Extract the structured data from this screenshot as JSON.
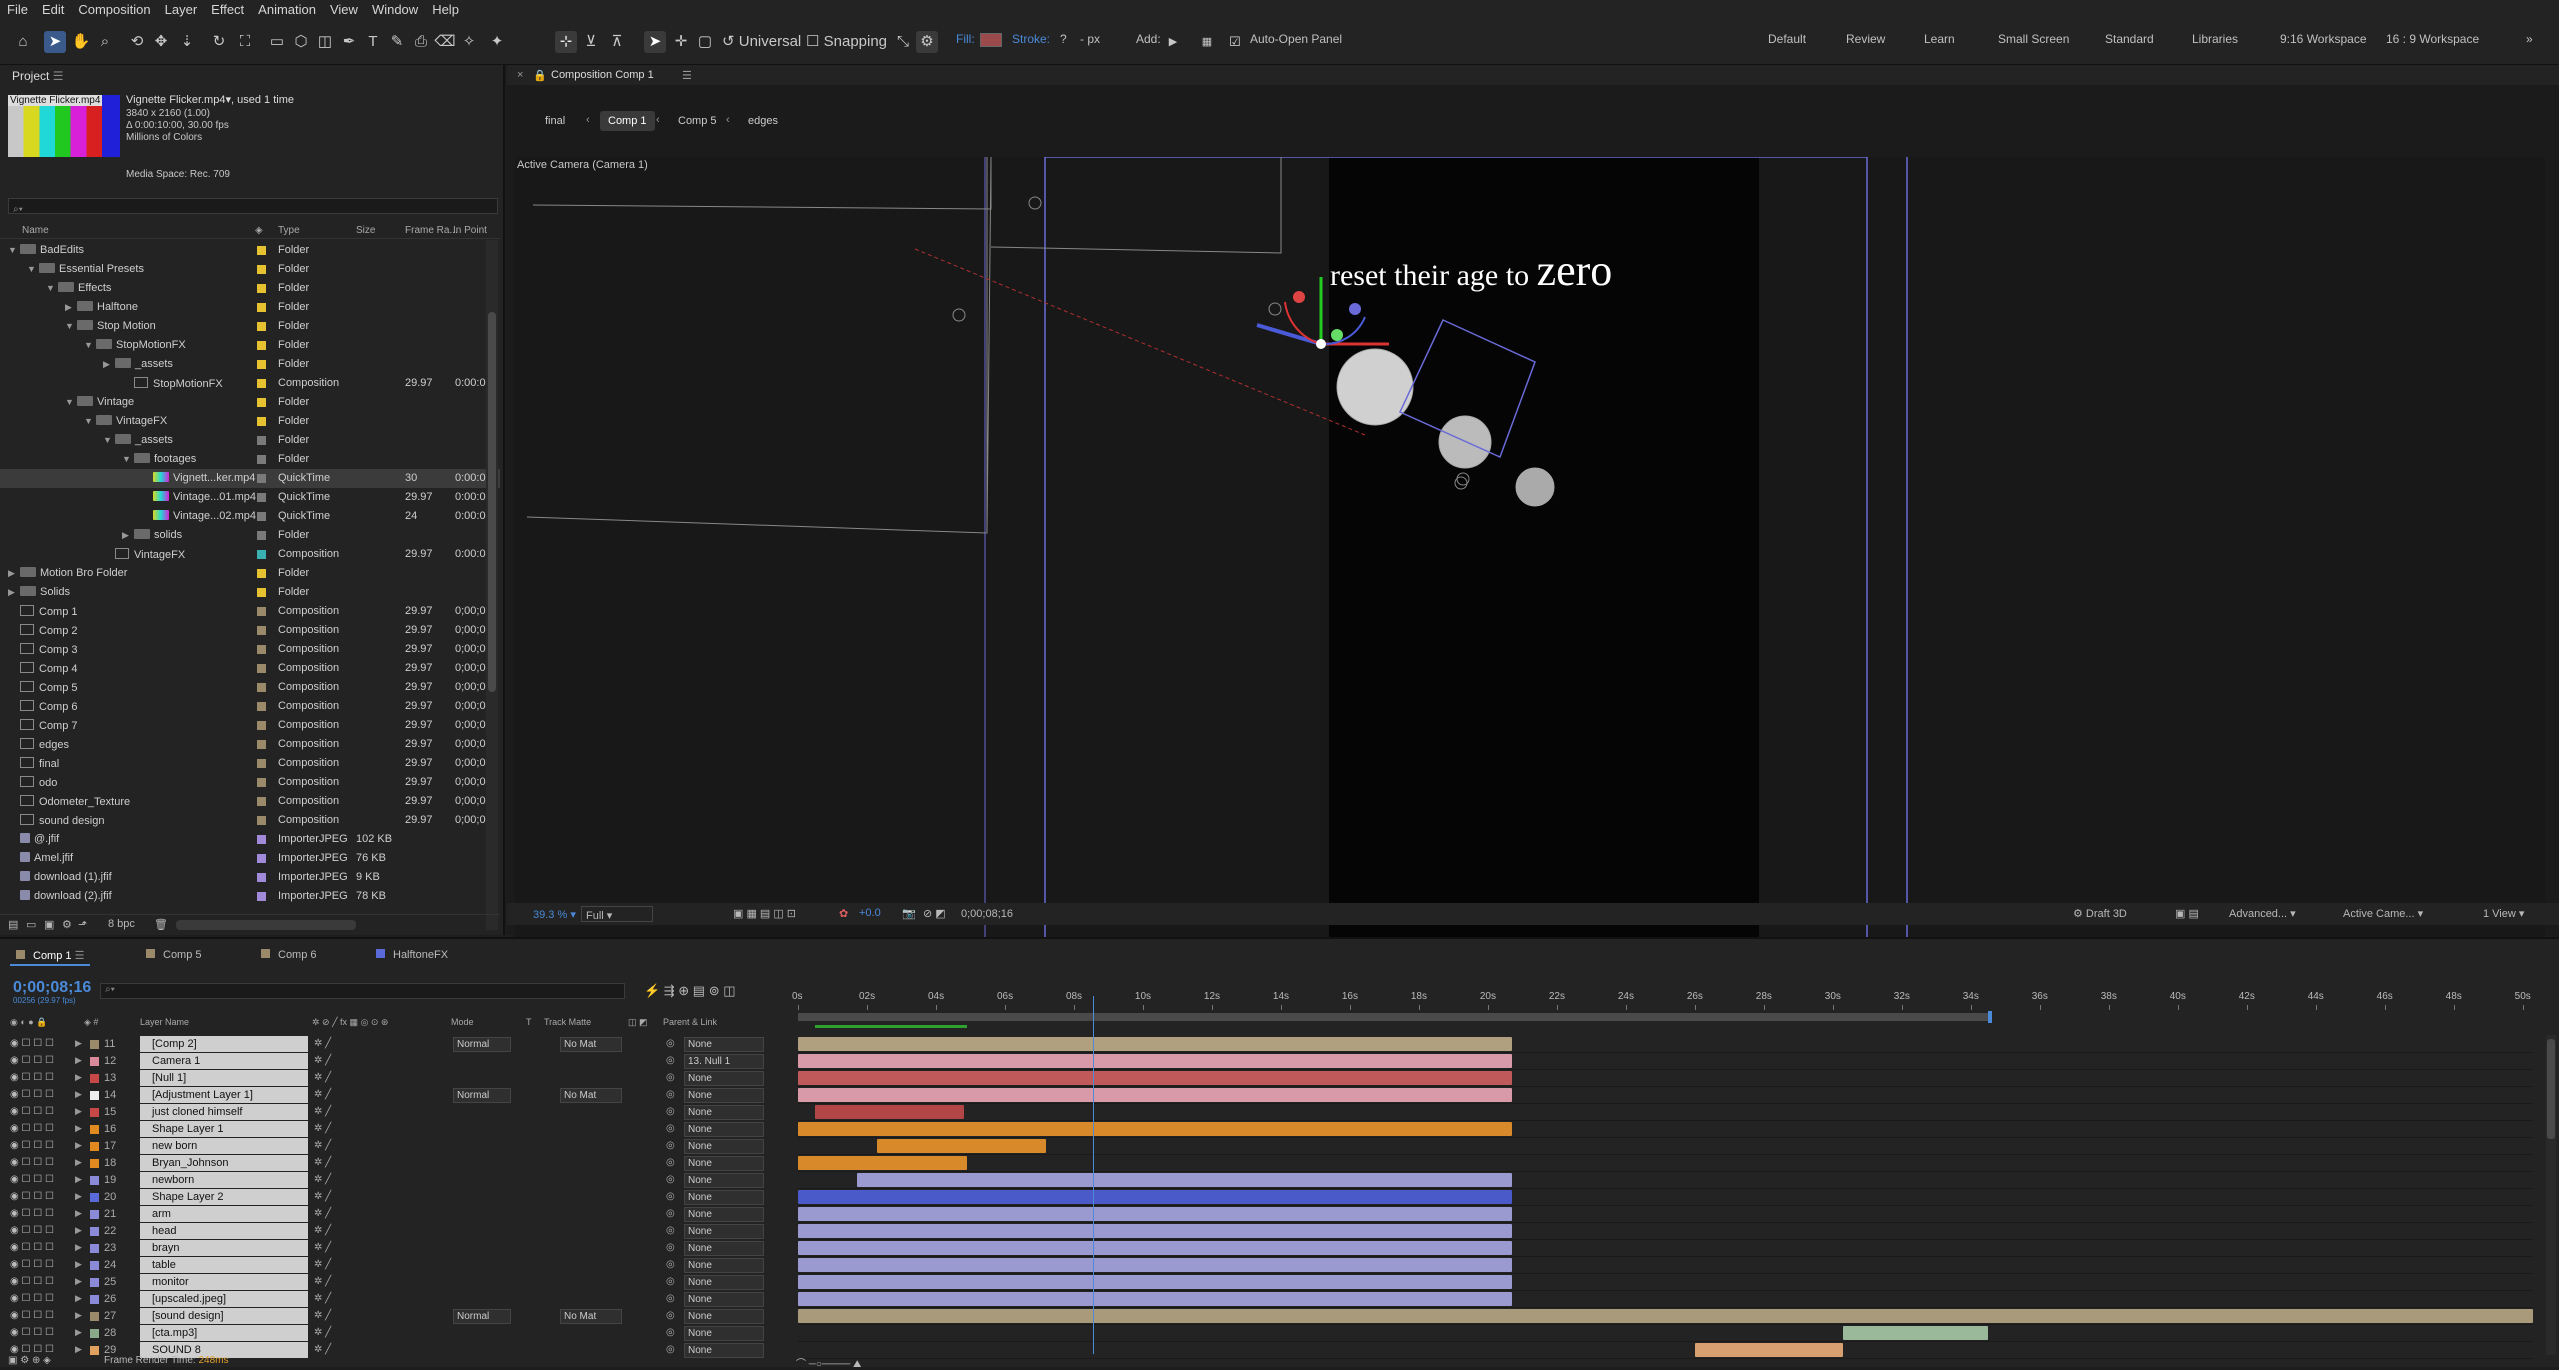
{
  "menu": [
    "File",
    "Edit",
    "Composition",
    "Layer",
    "Effect",
    "Animation",
    "View",
    "Window",
    "Help"
  ],
  "toolbar": {
    "universal": "Universal",
    "snapping": "Snapping",
    "fill": "Fill:",
    "stroke": "Stroke:",
    "stroke_val": "?",
    "px": "- px",
    "add": "Add:",
    "auto_open": "Auto-Open Panel"
  },
  "workspaces": [
    "Default",
    "Review",
    "Learn",
    "Small Screen",
    "Standard",
    "Libraries",
    "9:16 Workspace",
    "16 : 9 Workspace"
  ],
  "project": {
    "title": "Project",
    "file_name": "Vignette Flicker.mp4",
    "used": ", used 1 time",
    "res": "3840 x 2160 (1.00)",
    "dur": "Δ 0:00:10:00, 30.00 fps",
    "colors": "Millions of Colors",
    "media_space": "Media Space: Rec. 709",
    "search_placeholder": "⌕▾",
    "cols": {
      "name": "Name",
      "type": "Type",
      "size": "Size",
      "frame_rate": "Frame Ra...",
      "in_point": "In Point"
    },
    "rows": [
      {
        "name": "BadEdits",
        "type": "Folder",
        "size": "",
        "fr": "",
        "ip": "",
        "indent": 0,
        "tri": "v",
        "color": "#e6c230",
        "icon": "folder"
      },
      {
        "name": "Essential Presets",
        "type": "Folder",
        "size": "",
        "fr": "",
        "ip": "",
        "indent": 1,
        "tri": "v",
        "color": "#e6c230",
        "icon": "folder"
      },
      {
        "name": "Effects",
        "type": "Folder",
        "size": "",
        "fr": "",
        "ip": "",
        "indent": 2,
        "tri": "v",
        "color": "#e6c230",
        "icon": "folder"
      },
      {
        "name": "Halftone",
        "type": "Folder",
        "size": "",
        "fr": "",
        "ip": "",
        "indent": 3,
        "tri": ">",
        "color": "#e6c230",
        "icon": "folder"
      },
      {
        "name": "Stop Motion",
        "type": "Folder",
        "size": "",
        "fr": "",
        "ip": "",
        "indent": 3,
        "tri": "v",
        "color": "#e6c230",
        "icon": "folder"
      },
      {
        "name": "StopMotionFX",
        "type": "Folder",
        "size": "",
        "fr": "",
        "ip": "",
        "indent": 4,
        "tri": "v",
        "color": "#e6c230",
        "icon": "folder"
      },
      {
        "name": "_assets",
        "type": "Folder",
        "size": "",
        "fr": "",
        "ip": "",
        "indent": 5,
        "tri": ">",
        "color": "#e6c230",
        "icon": "folder"
      },
      {
        "name": "StopMotionFX",
        "type": "Composition",
        "size": "",
        "fr": "29.97",
        "ip": "0:00:0",
        "indent": 6,
        "tri": "",
        "color": "#e6c230",
        "icon": "comp"
      },
      {
        "name": "Vintage",
        "type": "Folder",
        "size": "",
        "fr": "",
        "ip": "",
        "indent": 3,
        "tri": "v",
        "color": "#e6c230",
        "icon": "folder"
      },
      {
        "name": "VintageFX",
        "type": "Folder",
        "size": "",
        "fr": "",
        "ip": "",
        "indent": 4,
        "tri": "v",
        "color": "#e6c230",
        "icon": "folder"
      },
      {
        "name": "_assets",
        "type": "Folder",
        "size": "",
        "fr": "",
        "ip": "",
        "indent": 5,
        "tri": "v",
        "color": "#7a7a7a",
        "icon": "folder"
      },
      {
        "name": "footages",
        "type": "Folder",
        "size": "",
        "fr": "",
        "ip": "",
        "indent": 6,
        "tri": "v",
        "color": "#7a7a7a",
        "icon": "folder"
      },
      {
        "name": "Vignett...ker.mp4",
        "type": "QuickTime",
        "size": "",
        "fr": "30",
        "ip": "0:00:0",
        "indent": 7,
        "tri": "",
        "color": "#7a7a7a",
        "icon": "media",
        "sel": true
      },
      {
        "name": "Vintage...01.mp4",
        "type": "QuickTime",
        "size": "",
        "fr": "29.97",
        "ip": "0:00:0",
        "indent": 7,
        "tri": "",
        "color": "#7a7a7a",
        "icon": "media"
      },
      {
        "name": "Vintage...02.mp4",
        "type": "QuickTime",
        "size": "",
        "fr": "24",
        "ip": "0:00:0",
        "indent": 7,
        "tri": "",
        "color": "#7a7a7a",
        "icon": "media"
      },
      {
        "name": "solids",
        "type": "Folder",
        "size": "",
        "fr": "",
        "ip": "",
        "indent": 6,
        "tri": ">",
        "color": "#7a7a7a",
        "icon": "folder"
      },
      {
        "name": "VintageFX",
        "type": "Composition",
        "size": "",
        "fr": "29.97",
        "ip": "0:00:0",
        "indent": 5,
        "tri": "",
        "color": "#3ab0b0",
        "icon": "comp"
      },
      {
        "name": "Motion Bro Folder",
        "type": "Folder",
        "size": "",
        "fr": "",
        "ip": "",
        "indent": 0,
        "tri": ">",
        "color": "#e6c230",
        "icon": "folder"
      },
      {
        "name": "Solids",
        "type": "Folder",
        "size": "",
        "fr": "",
        "ip": "",
        "indent": 0,
        "tri": ">",
        "color": "#e6c230",
        "icon": "folder"
      },
      {
        "name": "Comp 1",
        "type": "Composition",
        "size": "",
        "fr": "29.97",
        "ip": "0;00;0",
        "indent": 0,
        "tri": "",
        "color": "#9a8a6a",
        "icon": "comp"
      },
      {
        "name": "Comp 2",
        "type": "Composition",
        "size": "",
        "fr": "29.97",
        "ip": "0;00;0",
        "indent": 0,
        "tri": "",
        "color": "#9a8a6a",
        "icon": "comp"
      },
      {
        "name": "Comp 3",
        "type": "Composition",
        "size": "",
        "fr": "29.97",
        "ip": "0;00;0",
        "indent": 0,
        "tri": "",
        "color": "#9a8a6a",
        "icon": "comp"
      },
      {
        "name": "Comp 4",
        "type": "Composition",
        "size": "",
        "fr": "29.97",
        "ip": "0;00;0",
        "indent": 0,
        "tri": "",
        "color": "#9a8a6a",
        "icon": "comp"
      },
      {
        "name": "Comp 5",
        "type": "Composition",
        "size": "",
        "fr": "29.97",
        "ip": "0;00;0",
        "indent": 0,
        "tri": "",
        "color": "#9a8a6a",
        "icon": "comp"
      },
      {
        "name": "Comp 6",
        "type": "Composition",
        "size": "",
        "fr": "29.97",
        "ip": "0;00;0",
        "indent": 0,
        "tri": "",
        "color": "#9a8a6a",
        "icon": "comp"
      },
      {
        "name": "Comp 7",
        "type": "Composition",
        "size": "",
        "fr": "29.97",
        "ip": "0;00;0",
        "indent": 0,
        "tri": "",
        "color": "#9a8a6a",
        "icon": "comp"
      },
      {
        "name": "edges",
        "type": "Composition",
        "size": "",
        "fr": "29.97",
        "ip": "0;00;0",
        "indent": 0,
        "tri": "",
        "color": "#9a8a6a",
        "icon": "comp"
      },
      {
        "name": "final",
        "type": "Composition",
        "size": "",
        "fr": "29.97",
        "ip": "0;00;0",
        "indent": 0,
        "tri": "",
        "color": "#9a8a6a",
        "icon": "comp"
      },
      {
        "name": "odo",
        "type": "Composition",
        "size": "",
        "fr": "29.97",
        "ip": "0;00;0",
        "indent": 0,
        "tri": "",
        "color": "#9a8a6a",
        "icon": "comp"
      },
      {
        "name": "Odometer_Texture",
        "type": "Composition",
        "size": "",
        "fr": "29.97",
        "ip": "0;00;0",
        "indent": 0,
        "tri": "",
        "color": "#9a8a6a",
        "icon": "comp"
      },
      {
        "name": "sound design",
        "type": "Composition",
        "size": "",
        "fr": "29.97",
        "ip": "0;00;0",
        "indent": 0,
        "tri": "",
        "color": "#9a8a6a",
        "icon": "comp"
      },
      {
        "name": "@.jfif",
        "type": "ImporterJPEG",
        "size": "102 KB",
        "fr": "",
        "ip": "",
        "indent": 0,
        "tri": "",
        "color": "#a18ad8",
        "icon": "file"
      },
      {
        "name": "Amel.jfif",
        "type": "ImporterJPEG",
        "size": "76 KB",
        "fr": "",
        "ip": "",
        "indent": 0,
        "tri": "",
        "color": "#a18ad8",
        "icon": "file"
      },
      {
        "name": "download (1).jfif",
        "type": "ImporterJPEG",
        "size": "9 KB",
        "fr": "",
        "ip": "",
        "indent": 0,
        "tri": "",
        "color": "#a18ad8",
        "icon": "file"
      },
      {
        "name": "download (2).jfif",
        "type": "ImporterJPEG",
        "size": "78 KB",
        "fr": "",
        "ip": "",
        "indent": 0,
        "tri": "",
        "color": "#a18ad8",
        "icon": "file"
      }
    ],
    "bpc": "8 bpc"
  },
  "comp": {
    "panel_title": "Composition Comp 1",
    "breadcrumbs": [
      "final",
      "Comp 1",
      "Comp 5",
      "edges"
    ],
    "camera_label": "Active Camera (Camera 1)",
    "headline": "reset their age to ",
    "headline_big": "zero",
    "zoom": "39.3",
    "zoom_unit": "%",
    "resolution": "Full",
    "exposure": "+0.0",
    "timecode": "0;00;08;16",
    "renderer": "Draft 3D",
    "advanced": "Advanced...",
    "camera_select": "Active Came...",
    "views": "1 View"
  },
  "timeline": {
    "tabs": [
      {
        "name": "Comp 1",
        "color": "#9a8a6a"
      },
      {
        "name": "Comp 5",
        "color": "#9a8a6a"
      },
      {
        "name": "Comp 6",
        "color": "#9a8a6a"
      },
      {
        "name": "HalftoneFX",
        "color": "#5a6ad8"
      }
    ],
    "timecode": "0;00;08;16",
    "frames": "00256 (29.97 fps)",
    "search_placeholder": "⌕▾",
    "col_layer": "Layer Name",
    "col_mode": "Mode",
    "col_t": "T",
    "col_matte": "Track Matte",
    "col_parent": "Parent & Link",
    "ticks": [
      "0s",
      "02s",
      "04s",
      "06s",
      "08s",
      "10s",
      "12s",
      "14s",
      "16s",
      "18s",
      "20s",
      "22s",
      "24s",
      "26s",
      "28s",
      "30s",
      "32s",
      "34s",
      "36s",
      "38s",
      "40s",
      "42s",
      "44s",
      "46s",
      "48s",
      "50s"
    ],
    "render_time_label": "Frame Render Time: ",
    "render_time": "248ms",
    "layers": [
      {
        "n": "11",
        "name": "[Comp 2]",
        "color": "#9a8a6a",
        "mode": "Normal",
        "matte": "No Mat",
        "parent": "None",
        "start": 0.0,
        "end": 20.7,
        "bar": "#b0a080"
      },
      {
        "n": "12",
        "name": "Camera 1",
        "color": "#d88a9a",
        "mode": "",
        "matte": "",
        "parent": "13. Null 1",
        "start": 0.0,
        "end": 20.7,
        "bar": "#d89aa8"
      },
      {
        "n": "13",
        "name": "[Null 1]",
        "color": "#c84848",
        "mode": "",
        "matte": "",
        "parent": "None",
        "start": 0.0,
        "end": 20.7,
        "bar": "#c05a5a"
      },
      {
        "n": "14",
        "name": "[Adjustment Layer 1]",
        "color": "#eeeeee",
        "mode": "Normal",
        "matte": "No Mat",
        "parent": "None",
        "start": 0.0,
        "end": 20.7,
        "bar": "#d89aa8"
      },
      {
        "n": "15",
        "name": "just cloned himself",
        "color": "#c84848",
        "mode": "",
        "matte": "",
        "parent": "None",
        "start": 0.5,
        "end": 4.8,
        "bar": "#b24646"
      },
      {
        "n": "16",
        "name": "Shape Layer 1",
        "color": "#e08a20",
        "mode": "",
        "matte": "",
        "parent": "None",
        "start": 0.0,
        "end": 20.7,
        "bar": "#d88a2a"
      },
      {
        "n": "17",
        "name": "new born",
        "color": "#e08a20",
        "mode": "",
        "matte": "",
        "parent": "None",
        "start": 2.3,
        "end": 7.2,
        "bar": "#d88a2a"
      },
      {
        "n": "18",
        "name": "Bryan_Johnson",
        "color": "#e08a20",
        "mode": "",
        "matte": "",
        "parent": "None",
        "start": 0.0,
        "end": 4.9,
        "bar": "#d88a2a"
      },
      {
        "n": "19",
        "name": "newborn",
        "color": "#8a8ad8",
        "mode": "",
        "matte": "",
        "parent": "None",
        "start": 1.7,
        "end": 20.7,
        "bar": "#9a9ad0"
      },
      {
        "n": "20",
        "name": "Shape Layer 2",
        "color": "#5a6ad8",
        "mode": "",
        "matte": "",
        "parent": "None",
        "start": 0.0,
        "end": 20.7,
        "bar": "#4a5ac8"
      },
      {
        "n": "21",
        "name": "arm",
        "color": "#8a8ad8",
        "mode": "",
        "matte": "",
        "parent": "None",
        "start": 0.0,
        "end": 20.7,
        "bar": "#9a9ad0"
      },
      {
        "n": "22",
        "name": "head",
        "color": "#8a8ad8",
        "mode": "",
        "matte": "",
        "parent": "None",
        "start": 0.0,
        "end": 20.7,
        "bar": "#9a9ad0"
      },
      {
        "n": "23",
        "name": "brayn",
        "color": "#8a8ad8",
        "mode": "",
        "matte": "",
        "parent": "None",
        "start": 0.0,
        "end": 20.7,
        "bar": "#9a9ad0"
      },
      {
        "n": "24",
        "name": "table",
        "color": "#8a8ad8",
        "mode": "",
        "matte": "",
        "parent": "None",
        "start": 0.0,
        "end": 20.7,
        "bar": "#9a9ad0"
      },
      {
        "n": "25",
        "name": "monitor",
        "color": "#8a8ad8",
        "mode": "",
        "matte": "",
        "parent": "None",
        "start": 0.0,
        "end": 20.7,
        "bar": "#9a9ad0"
      },
      {
        "n": "26",
        "name": "[upscaled.jpeg]",
        "color": "#8a8ad8",
        "mode": "",
        "matte": "",
        "parent": "None",
        "start": 0.0,
        "end": 20.7,
        "bar": "#9a9ad0"
      },
      {
        "n": "27",
        "name": "[sound design]",
        "color": "#9a8a6a",
        "mode": "Normal",
        "matte": "No Mat",
        "parent": "None",
        "start": 0.0,
        "end": 50.3,
        "bar": "#a89a7a"
      },
      {
        "n": "28",
        "name": "[cta.mp3]",
        "color": "#8aa88a",
        "mode": "",
        "matte": "",
        "parent": "None",
        "start": 30.3,
        "end": 34.5,
        "bar": "#9ab89a"
      },
      {
        "n": "29",
        "name": "SOUND 8",
        "color": "#e0a060",
        "mode": "",
        "matte": "",
        "parent": "None",
        "start": 26.0,
        "end": 30.3,
        "bar": "#d8a070"
      }
    ],
    "playhead": 8.55,
    "work_end": 34.5,
    "total": 50.3
  }
}
